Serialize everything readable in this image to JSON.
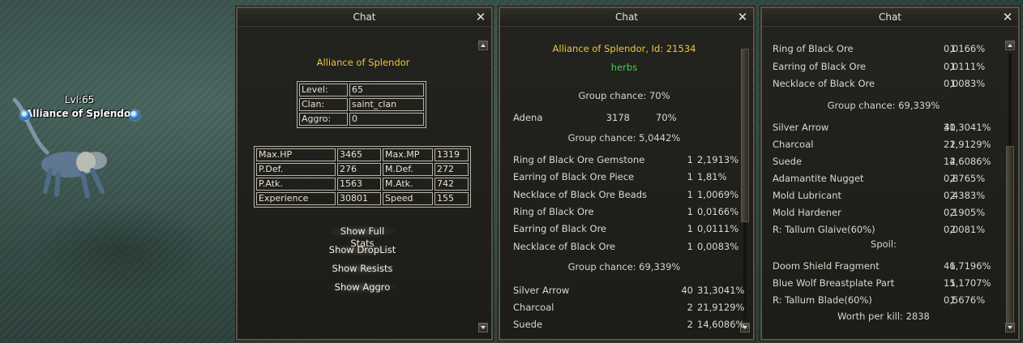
{
  "scene": {
    "level_label": "Lvl:65",
    "npc_name": "Alliance of Splendor"
  },
  "windows": [
    {
      "title": "Chat",
      "name": "Alliance of Splendor",
      "stats_small": [
        {
          "label": "Level:",
          "value": "65"
        },
        {
          "label": "Clan:",
          "value": "saint_clan"
        },
        {
          "label": "Aggro:",
          "value": "0"
        }
      ],
      "stats_big": [
        {
          "l1": "Max.HP",
          "v1": "3465",
          "l2": "Max.MP",
          "v2": "1319"
        },
        {
          "l1": "P.Def.",
          "v1": "276",
          "l2": "M.Def.",
          "v2": "272"
        },
        {
          "l1": "P.Atk.",
          "v1": "1563",
          "l2": "M.Atk.",
          "v2": "742"
        },
        {
          "l1": "Experience",
          "v1": "30801",
          "l2": "Speed",
          "v2": "155"
        }
      ],
      "buttons": [
        "Show Full Stats",
        "Show DropList",
        "Show Resists",
        "Show Aggro"
      ]
    },
    {
      "title": "Chat",
      "header": "Alliance of Splendor, Id: 21534",
      "subheader": "herbs",
      "group1": "Group chance: 70%",
      "adena": {
        "name": "Adena",
        "qty": "3178",
        "pct": "70%"
      },
      "group2": "Group chance: 5,0442%",
      "items2": [
        {
          "name": "Ring of Black Ore Gemstone",
          "qty": "1",
          "pct": "2,1913%"
        },
        {
          "name": "Earring of Black Ore Piece",
          "qty": "1",
          "pct": "1,81%"
        },
        {
          "name": "Necklace of Black Ore Beads",
          "qty": "1",
          "pct": "1,0069%"
        },
        {
          "name": "Ring of Black Ore",
          "qty": "1",
          "pct": "0,0166%"
        },
        {
          "name": "Earring of Black Ore",
          "qty": "1",
          "pct": "0,0111%"
        },
        {
          "name": "Necklace of Black Ore",
          "qty": "1",
          "pct": "0,0083%"
        }
      ],
      "group3": "Group chance: 69,339%",
      "items3": [
        {
          "name": "Silver Arrow",
          "qty": "40",
          "pct": "31,3041%"
        },
        {
          "name": "Charcoal",
          "qty": "2",
          "pct": "21,9129%"
        },
        {
          "name": "Suede",
          "qty": "2",
          "pct": "14,6086%"
        }
      ]
    },
    {
      "title": "Chat",
      "items_top": [
        {
          "name": "Ring of Black Ore",
          "qty": "1",
          "pct": "0,0166%"
        },
        {
          "name": "Earring of Black Ore",
          "qty": "1",
          "pct": "0,0111%"
        },
        {
          "name": "Necklace of Black Ore",
          "qty": "1",
          "pct": "0,0083%"
        }
      ],
      "group": "Group chance: 69,339%",
      "items_mid": [
        {
          "name": "Silver Arrow",
          "qty": "40",
          "pct": "31,3041%"
        },
        {
          "name": "Charcoal",
          "qty": "2",
          "pct": "21,9129%"
        },
        {
          "name": "Suede",
          "qty": "2",
          "pct": "14,6086%"
        },
        {
          "name": "Adamantite Nugget",
          "qty": "2",
          "pct": "0,8765%"
        },
        {
          "name": "Mold Lubricant",
          "qty": "2",
          "pct": "0,4383%"
        },
        {
          "name": "Mold Hardener",
          "qty": "2",
          "pct": "0,1905%"
        },
        {
          "name": "R: Tallum Glaive(60%)",
          "qty": "2",
          "pct": "0,0081%"
        }
      ],
      "spoil_label": "Spoil:",
      "spoil_items": [
        {
          "name": "Doom Shield Fragment",
          "qty": "1",
          "pct": "46,7196%"
        },
        {
          "name": "Blue Wolf Breastplate Part",
          "qty": "1",
          "pct": "15,1707%"
        },
        {
          "name": "R: Tallum Blade(60%)",
          "qty": "1",
          "pct": "0,5676%"
        }
      ],
      "worth": "Worth per kill: 2838"
    }
  ],
  "colors": {
    "gold": "#f0c53b",
    "green": "#3fd24a"
  }
}
